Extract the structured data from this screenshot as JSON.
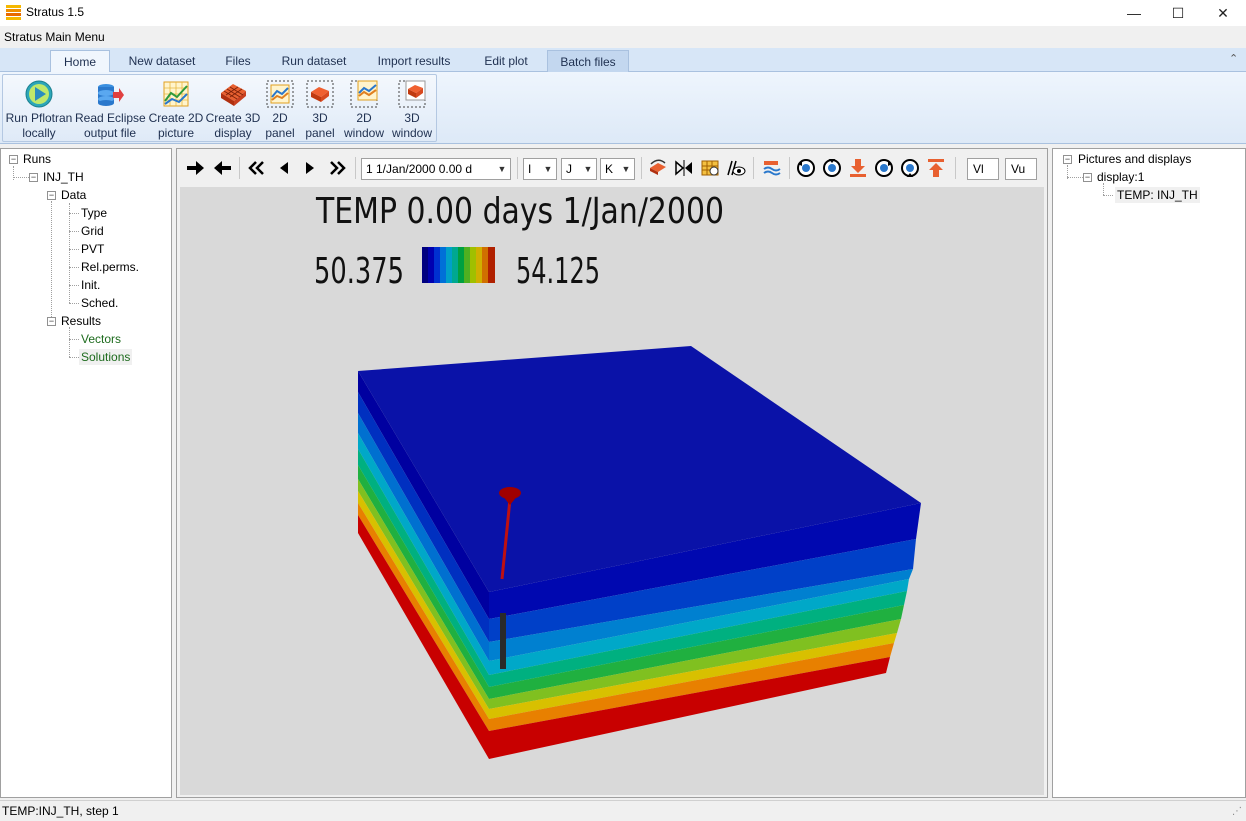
{
  "window": {
    "title": "Stratus 1.5",
    "minimize": "—",
    "maximize": "☐",
    "close": "✕"
  },
  "menu_label": "Stratus Main Menu",
  "ribbon": {
    "tabs": [
      {
        "label": "Home",
        "state": "active"
      },
      {
        "label": "New dataset",
        "state": ""
      },
      {
        "label": "Files",
        "state": ""
      },
      {
        "label": "Run dataset",
        "state": ""
      },
      {
        "label": "Import results",
        "state": ""
      },
      {
        "label": "Edit plot",
        "state": ""
      },
      {
        "label": "Batch files",
        "state": "highlight"
      }
    ],
    "collapse_icon": "chevron-up",
    "buttons": [
      {
        "label": "Run Pflotran\nlocally",
        "icon": "play-icon"
      },
      {
        "label": "Read Eclipse\noutput file",
        "icon": "database-import-icon"
      },
      {
        "label": "Create 2D\npicture",
        "icon": "chart-2d-icon"
      },
      {
        "label": "Create 3D\ndisplay",
        "icon": "grid-3d-icon"
      },
      {
        "label": "2D\npanel",
        "icon": "panel-2d-icon"
      },
      {
        "label": "3D\npanel",
        "icon": "panel-3d-icon"
      },
      {
        "label": "2D\nwindow",
        "icon": "window-2d-icon"
      },
      {
        "label": "3D\nwindow",
        "icon": "window-3d-icon"
      }
    ]
  },
  "left_tree": {
    "root": "Runs",
    "run": "INJ_TH",
    "data_node": "Data",
    "data_items": [
      "Type",
      "Grid",
      "PVT",
      "Rel.perms.",
      "Init.",
      "Sched."
    ],
    "results_node": "Results",
    "results_items": [
      "Vectors",
      "Solutions"
    ]
  },
  "right_tree": {
    "root": "Pictures and displays",
    "display": "display:1",
    "item": "TEMP: INJ_TH"
  },
  "toolbar": {
    "step_combo": "1  1/Jan/2000 0.00 d",
    "i_combo": "I",
    "j_combo": "J",
    "k_combo": "K",
    "vl_box": "Vl",
    "vu_box": "Vu"
  },
  "viewport": {
    "title": "TEMP 0.00 days 1/Jan/2000",
    "scale_min": "50.375",
    "scale_max": "54.125",
    "colors": {
      "background": "#d9d9d9",
      "top": "#0a12a8",
      "layers_front": [
        "#00008f",
        "#0008b6",
        "#0038c8",
        "#0070d0",
        "#00a8c8",
        "#00b0a0",
        "#00b060",
        "#30b830",
        "#90c820",
        "#d8c000",
        "#e89000",
        "#d04000",
        "#c00000"
      ]
    }
  },
  "status": {
    "text": "TEMP:INJ_TH, step 1"
  }
}
